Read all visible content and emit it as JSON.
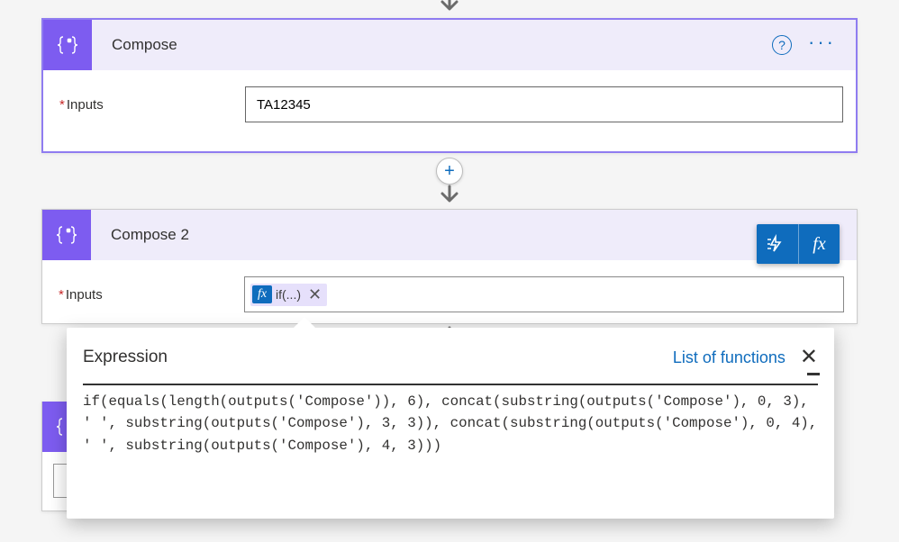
{
  "arrow": "↓",
  "compose": {
    "title": "Compose",
    "help_icon_text": "?",
    "more_icon_text": "···",
    "inputs_label": "Inputs",
    "inputs_required": "*",
    "inputs_value": "TA12345"
  },
  "plus": "+",
  "compose2": {
    "title": "Compose 2",
    "inputs_label": "Inputs",
    "inputs_required": "*",
    "token_fx": "fx",
    "token_label": "if(...)",
    "token_x": "✕"
  },
  "tools": {
    "lightning": "lightning",
    "fx": "fx"
  },
  "expression": {
    "title": "Expression",
    "link": "List of functions",
    "close": "✕",
    "code": "if(equals(length(outputs('Compose')), 6), concat(substring(outputs('Compose'), 0, 3), ' ', substring(outputs('Compose'), 3, 3)), concat(substring(outputs('Compose'), 0, 4), ' ', substring(outputs('Compose'), 4, 3)))"
  }
}
